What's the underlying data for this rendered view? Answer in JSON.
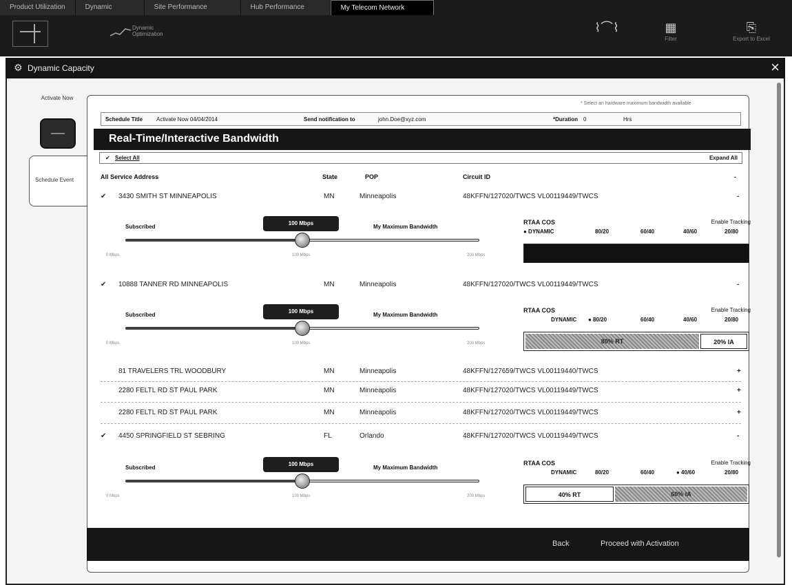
{
  "top_tabs": [
    "Product Utilization",
    "Dynamic",
    "Site Performance",
    "Hub Performance",
    "My Telecom Network"
  ],
  "toolbar": {
    "dynamic_option_line1": "Dynamic",
    "dynamic_option_line2": "Optimization",
    "right_tools": [
      {
        "label": ""
      },
      {
        "label": "Filter"
      },
      {
        "label": "Export to Excel"
      }
    ]
  },
  "modal": {
    "title": "Dynamic Capacity"
  },
  "steps": {
    "step1": "Activate Now",
    "step2": "Schedule Event"
  },
  "recommend_note": "* Select an hardware maximum bandwidth available",
  "schedule": {
    "title_label": "Schedule Title",
    "title_value": "Activate Now 04/04/2014",
    "notify_label": "Send notification to",
    "notify_value": "john.Doe@xyz.com",
    "duration_label": "*Duration",
    "duration_value": "0",
    "duration_unit": "Hrs"
  },
  "band_title": "Real-Time/Interactive Bandwidth",
  "select_all": "Select All",
  "expand_all": "Expand All",
  "columns": {
    "address": "All Service Address",
    "state": "State",
    "pop": "POP",
    "circuit": "Circuit ID",
    "dash": "-"
  },
  "rows": [
    {
      "check": "✔",
      "address": "3430 SMITH ST MINNEAPOLIS",
      "state": "MN",
      "pop": "Minneapolis",
      "circuit": "48KFFN/127020/TWCS  VL00119449/TWCS",
      "right": "-"
    },
    {
      "check": "✔",
      "address": "10888 TANNER RD MINNEAPOLIS",
      "state": "MN",
      "pop": "Minneapolis",
      "circuit": "48KFFN/127020/TWCS  VL00119449/TWCS",
      "right": "-"
    },
    {
      "check": "",
      "address": "81 TRAVELERS TRL WOODBURY",
      "state": "MN",
      "pop": "Minneapolis",
      "circuit": "48KFFN/127659/TWCS  VL00119440/TWCS",
      "right": "+"
    },
    {
      "check": "",
      "address": "2280 FELTL RD ST PAUL PARK",
      "state": "MN",
      "pop": "Minneapolis",
      "circuit": "48KFFN/127020/TWCS  VL00119449/TWCS",
      "right": "+"
    },
    {
      "check": "",
      "address": "2280 FELTL RD ST PAUL PARK",
      "state": "MN",
      "pop": "Minneapolis",
      "circuit": "48KFFN/127020/TWCS  VL00119449/TWCS",
      "right": "+"
    },
    {
      "check": "✔",
      "address": "4450 SPRINGFIELD ST SEBRING",
      "state": "FL",
      "pop": "Orlando",
      "circuit": "48KFFN/127020/TWCS  VL00119449/TWCS",
      "right": "-"
    }
  ],
  "sliders": [
    {
      "subscribed": "Subscribed",
      "value": "100 Mbps",
      "max_label": "My Maximum Bandwidth",
      "level": 0.5,
      "tick_min": "0 Mbps",
      "tick_mid": "100 Mbps",
      "tick_max": "200 Mbps"
    },
    {
      "subscribed": "Subscribed",
      "value": "100 Mbps",
      "max_label": "My Maximum Bandwidth",
      "level": 0.5,
      "tick_min": "0 Mbps",
      "tick_mid": "100 Mbps",
      "tick_max": "200 Mbps"
    },
    {
      "subscribed": "Subscribed",
      "value": "100 Mbps",
      "max_label": "My Maximum Bandwidth",
      "level": 0.5,
      "tick_min": "0 Mbps",
      "tick_mid": "100 Mbps",
      "tick_max": "200 Mbps"
    }
  ],
  "cos": [
    {
      "title": "RTAA COS",
      "enable": "Enable Tracking",
      "opts": [
        "● DYNAMIC",
        "80/20",
        "60/40",
        "40/60",
        "20/80"
      ],
      "seg_left": "",
      "seg_right": ""
    },
    {
      "title": "RTAA COS",
      "enable": "Enable Tracking",
      "opts": [
        "DYNAMIC",
        "● 80/20",
        "60/40",
        "40/60",
        "20/80"
      ],
      "seg_left": "80% RT",
      "seg_right": "20% IA"
    },
    {
      "title": "RTAA COS",
      "enable": "Enable Tracking",
      "opts": [
        "DYNAMIC",
        "80/20",
        "60/40",
        "● 40/60",
        "20/80"
      ],
      "seg_left": "40% RT",
      "seg_right": "60% IA"
    }
  ],
  "footer": {
    "back": "Back",
    "proceed": "Proceed with Activation"
  }
}
